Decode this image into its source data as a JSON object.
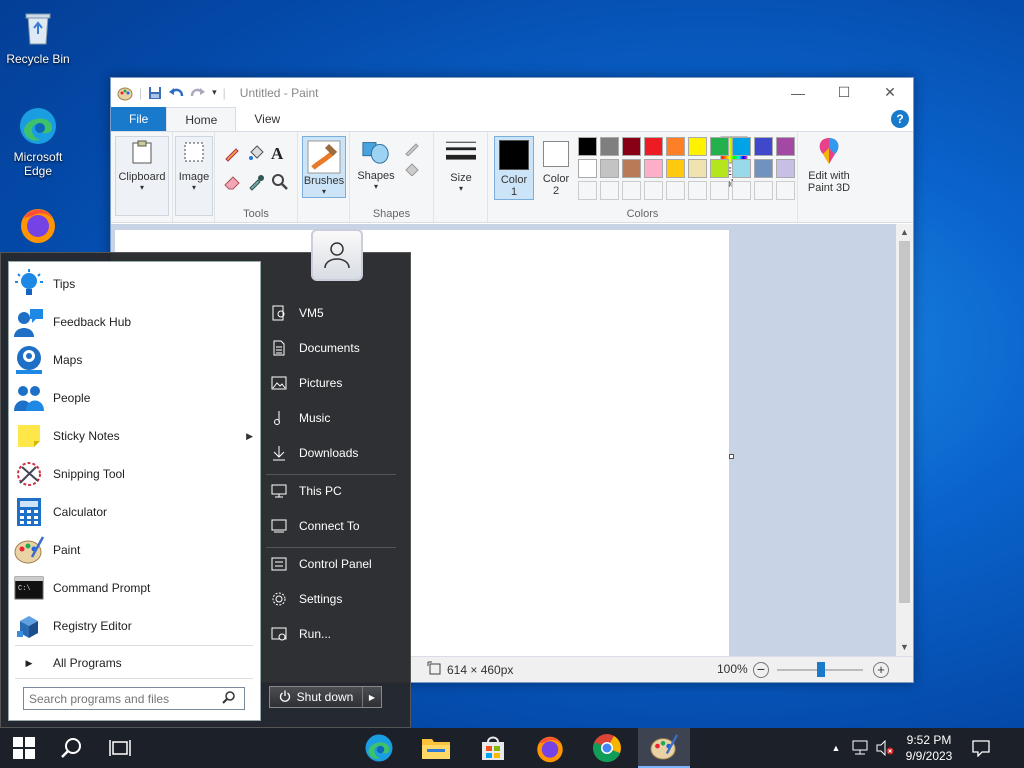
{
  "desktop": {
    "icons": [
      {
        "label": "Recycle Bin",
        "icon": "recycle-bin-icon"
      },
      {
        "label": "Microsoft Edge",
        "icon": "edge-icon"
      },
      {
        "label": "",
        "icon": "firefox-icon"
      }
    ]
  },
  "paint": {
    "title": "Untitled - Paint",
    "tabs": {
      "file": "File",
      "home": "Home",
      "view": "View"
    },
    "ribbon": {
      "clipboard": "Clipboard",
      "image": "Image",
      "tools_group": "Tools",
      "brushes": "Brushes",
      "shapes": "Shapes",
      "shapes_group": "Shapes",
      "size": "Size",
      "color1": "Color",
      "color1_num": "1",
      "color2": "Color",
      "color2_num": "2",
      "edit_colors": "Edit colors",
      "edit_paint3d": "Edit with Paint 3D",
      "colors_group": "Colors"
    },
    "palette_row1": [
      "#000000",
      "#7f7f7f",
      "#880015",
      "#ed1c24",
      "#ff7f27",
      "#fff200",
      "#22b14c",
      "#00a2e8",
      "#3f48cc",
      "#a349a4"
    ],
    "palette_row2": [
      "#ffffff",
      "#c3c3c3",
      "#b97a57",
      "#ffaec9",
      "#ffc90e",
      "#efe4b0",
      "#b5e61d",
      "#99d9ea",
      "#7092be",
      "#c8bfe7"
    ],
    "status": {
      "canvas_size": "614 × 460px",
      "zoom": "100%"
    }
  },
  "start_menu": {
    "programs": [
      {
        "label": "Tips",
        "icon": "tips-icon"
      },
      {
        "label": "Feedback Hub",
        "icon": "feedback-hub-icon"
      },
      {
        "label": "Maps",
        "icon": "maps-icon"
      },
      {
        "label": "People",
        "icon": "people-icon"
      },
      {
        "label": "Sticky Notes",
        "icon": "sticky-notes-icon"
      },
      {
        "label": "Snipping Tool",
        "icon": "snipping-tool-icon"
      },
      {
        "label": "Calculator",
        "icon": "calculator-icon"
      },
      {
        "label": "Paint",
        "icon": "paint-icon"
      },
      {
        "label": "Command Prompt",
        "icon": "command-prompt-icon"
      },
      {
        "label": "Registry Editor",
        "icon": "registry-editor-icon"
      }
    ],
    "all_programs": "All Programs",
    "search_placeholder": "Search programs and files",
    "right_links": [
      {
        "label": "VM5",
        "icon": "user-folder-icon"
      },
      {
        "label": "Documents",
        "icon": "documents-icon"
      },
      {
        "label": "Pictures",
        "icon": "pictures-icon"
      },
      {
        "label": "Music",
        "icon": "music-icon"
      },
      {
        "label": "Downloads",
        "icon": "downloads-icon"
      },
      {
        "label": "This PC",
        "icon": "this-pc-icon"
      },
      {
        "label": "Connect To",
        "icon": "connect-to-icon"
      },
      {
        "label": "Control Panel",
        "icon": "control-panel-icon"
      },
      {
        "label": "Settings",
        "icon": "settings-gear-icon"
      },
      {
        "label": "Run...",
        "icon": "run-icon"
      }
    ],
    "shutdown": "Shut down"
  },
  "taskbar": {
    "time": "9:52 PM",
    "date": "9/9/2023"
  }
}
